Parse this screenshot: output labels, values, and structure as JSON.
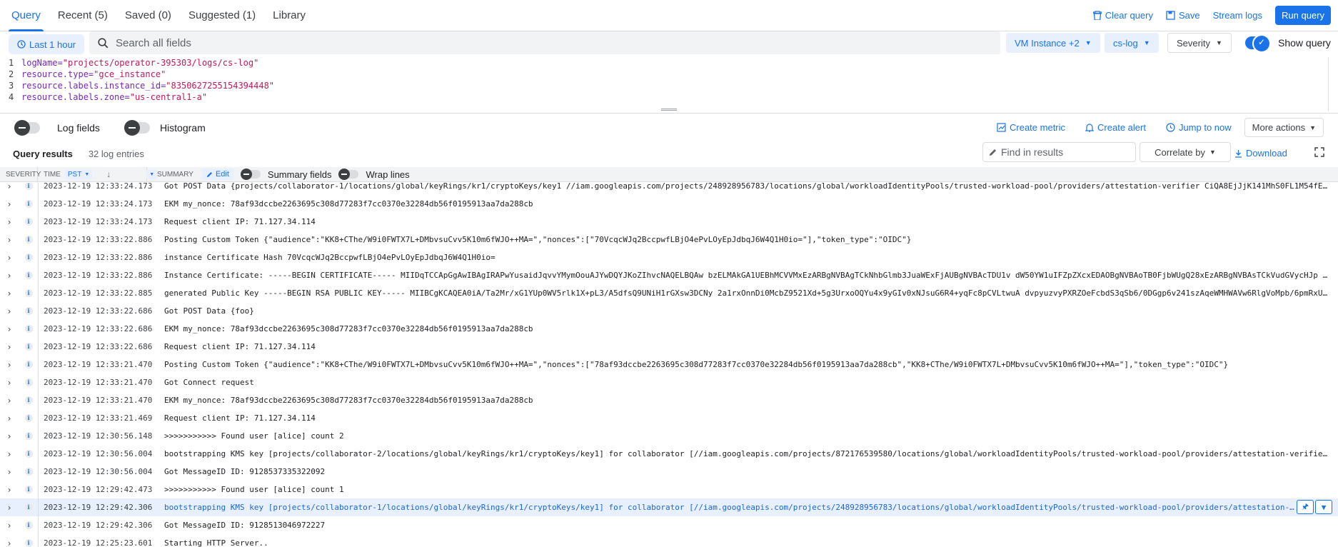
{
  "tabs": [
    "Query",
    "Recent (5)",
    "Saved (0)",
    "Suggested (1)",
    "Library"
  ],
  "toolbar": {
    "clear_query": "Clear query",
    "save": "Save",
    "stream_logs": "Stream logs",
    "run_query": "Run query"
  },
  "filters": {
    "time_range": "Last 1 hour",
    "search_placeholder": "Search all fields",
    "resource": "VM Instance +2",
    "log_name": "cs-log",
    "severity": "Severity",
    "show_query": "Show query"
  },
  "query_lines": [
    {
      "num": "1",
      "key": "logName=",
      "value": "\"projects/operator-395303/logs/cs-log\""
    },
    {
      "num": "2",
      "key": "resource.type=",
      "value": "\"gce_instance\""
    },
    {
      "num": "3",
      "key": "resource.labels.instance_id=",
      "value": "\"8350627255154394448\""
    },
    {
      "num": "4",
      "key": "resource.labels.zone=",
      "value": "\"us-central1-a\""
    }
  ],
  "options": {
    "log_fields": "Log fields",
    "histogram": "Histogram",
    "create_metric": "Create metric",
    "create_alert": "Create alert",
    "jump_to_now": "Jump to now",
    "more_actions": "More actions"
  },
  "results": {
    "title": "Query results",
    "count": "32 log entries",
    "find_placeholder": "Find in results",
    "correlate_by": "Correlate by",
    "download": "Download"
  },
  "table_header": {
    "severity": "SEVERITY",
    "time": "TIME",
    "timezone": "PST",
    "summary": "SUMMARY",
    "edit": "Edit",
    "summary_fields": "Summary fields",
    "wrap_lines": "Wrap lines"
  },
  "log_rows": [
    {
      "time": "2023-12-19 12:33:24.173",
      "summary": "Got POST Data  {projects/collaborator-1/locations/global/keyRings/kr1/cryptoKeys/key1 //iam.googleapis.com/projects/248928956783/locations/global/workloadIdentityPools/trusted-workload-pool/providers/attestation-verifier CiQA8EjJjK141MhS0FL1M54fE…"
    },
    {
      "time": "2023-12-19 12:33:24.173",
      "summary": "EKM my_nonce: 78af93dccbe2263695c308d77283f7cc0370e32284db56f0195913aa7da288cb"
    },
    {
      "time": "2023-12-19 12:33:24.173",
      "summary": "Request client IP: 71.127.34.114"
    },
    {
      "time": "2023-12-19 12:33:22.886",
      "summary": "Posting Custom Token {\"audience\":\"KK8+CThe/W9i0FWTX7L+DMbvsuCvv5K10m6fWJO++MA=\",\"nonces\":[\"70VcqcWJq2BccpwfLBjO4ePvLOyEpJdbqJ6W4Q1H0io=\"],\"token_type\":\"OIDC\"}"
    },
    {
      "time": "2023-12-19 12:33:22.886",
      "summary": "instance Certificate Hash 70VcqcWJq2BccpwfLBjO4ePvLOyEpJdbqJ6W4Q1H0io="
    },
    {
      "time": "2023-12-19 12:33:22.886",
      "summary": "Instance Certificate:  -----BEGIN CERTIFICATE----- MIIDqTCCApGgAwIBAgIRAPwYusaidJqvvYMymOouAJYwDQYJKoZIhvcNAQELBQAw bzELMAkGA1UEBhMCVVMxEzARBgNVBAgTCkNhbGlmb3JuaWExFjAUBgNVBAcTDU1v dW50YW1uIFZpZXcxEDAOBgNVBAoTB0FjbWUgQ28xEzARBgNVBAsTCkVudGVycHJp …"
    },
    {
      "time": "2023-12-19 12:33:22.885",
      "summary": "generated Public Key  -----BEGIN RSA PUBLIC KEY----- MIIBCgKCAQEA0iA/Ta2Mr/xG1YUp0WV5rlk1X+pL3/A5dfsQ9UNiH1rGXsw3DCNy 2a1rxOnnDi0McbZ9521Xd+5g3UrxoOQYu4x9yGIv0xNJsuG6R4+yqFc8pCVLtwuA dvpyuzvyPXRZOeFcbdS3qSb6/0DGgp6v241szAqeWMHWAVw6RlgVoMpb/6pmRxU…"
    },
    {
      "time": "2023-12-19 12:33:22.686",
      "summary": "Got POST Data  {foo}"
    },
    {
      "time": "2023-12-19 12:33:22.686",
      "summary": "EKM my_nonce: 78af93dccbe2263695c308d77283f7cc0370e32284db56f0195913aa7da288cb"
    },
    {
      "time": "2023-12-19 12:33:22.686",
      "summary": "Request client IP: 71.127.34.114"
    },
    {
      "time": "2023-12-19 12:33:21.470",
      "summary": "Posting Custom Token {\"audience\":\"KK8+CThe/W9i0FWTX7L+DMbvsuCvv5K10m6fWJO++MA=\",\"nonces\":[\"78af93dccbe2263695c308d77283f7cc0370e32284db56f0195913aa7da288cb\",\"KK8+CThe/W9i0FWTX7L+DMbvsuCvv5K10m6fWJO++MA=\"],\"token_type\":\"OIDC\"}"
    },
    {
      "time": "2023-12-19 12:33:21.470",
      "summary": "Got Connect request"
    },
    {
      "time": "2023-12-19 12:33:21.470",
      "summary": "EKM my_nonce: 78af93dccbe2263695c308d77283f7cc0370e32284db56f0195913aa7da288cb"
    },
    {
      "time": "2023-12-19 12:33:21.469",
      "summary": "Request client IP: 71.127.34.114"
    },
    {
      "time": "2023-12-19 12:30:56.148",
      "summary": ">>>>>>>>>>> Found user [alice] count  2"
    },
    {
      "time": "2023-12-19 12:30:56.004",
      "summary": "bootstrapping  KMS key [projects/collaborator-2/locations/global/keyRings/kr1/cryptoKeys/key1] for collaborator [//iam.googleapis.com/projects/872176539580/locations/global/workloadIdentityPools/trusted-workload-pool/providers/attestation-verifie…"
    },
    {
      "time": "2023-12-19 12:30:56.004",
      "summary": "Got MessageID ID: 9128537335322092"
    },
    {
      "time": "2023-12-19 12:29:42.473",
      "summary": ">>>>>>>>>>> Found user [alice] count  1"
    },
    {
      "time": "2023-12-19 12:29:42.306",
      "summary": "bootstrapping  KMS key [projects/collaborator-1/locations/global/keyRings/kr1/cryptoKeys/key1] for collaborator [//iam.googleapis.com/projects/248928956783/locations/global/workloadIdentityPools/trusted-workload-pool/providers/attestation-…"
    },
    {
      "time": "2023-12-19 12:29:42.306",
      "summary": "Got MessageID ID: 9128513046972227"
    },
    {
      "time": "2023-12-19 12:25:23.601",
      "summary": "Starting HTTP Server.."
    }
  ]
}
